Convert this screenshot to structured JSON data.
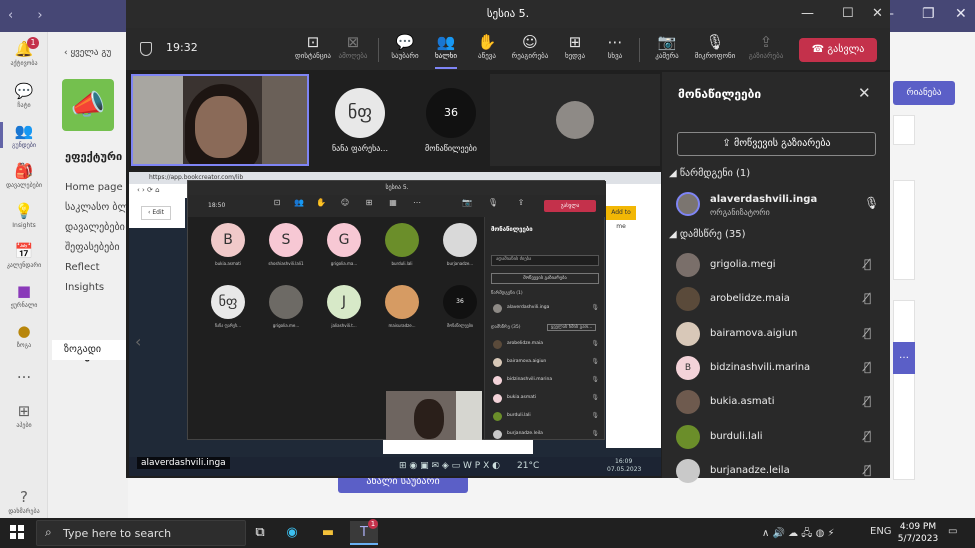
{
  "teams": {
    "rail": [
      {
        "label": "აქტივობა",
        "badge": "1"
      },
      {
        "label": "ჩატი"
      },
      {
        "label": "გუნდები"
      },
      {
        "label": "დავალებები"
      },
      {
        "label": "Insights"
      },
      {
        "label": "კალენდარი"
      },
      {
        "label": "ჟურნალი"
      },
      {
        "label": "ზოგა"
      },
      {
        "label": "..."
      },
      {
        "label": "აპები"
      },
      {
        "label": "დახმარება"
      }
    ],
    "back_label": "ყველა გუ",
    "team_name": "ეფექტური",
    "links": [
      "Home page",
      "საკლასო ბლ",
      "დავალებები",
      "შეფასებები",
      "Reflect",
      "Insights"
    ],
    "channels_header": "არხები",
    "channel": "ზოგადი",
    "right_button": "რიანება",
    "new_conversation": "ახალი საუბარი"
  },
  "meeting": {
    "title": "სესია 5.",
    "timer": "19:32",
    "toolbar": [
      {
        "label": "დისტანცია",
        "icon": "⊡"
      },
      {
        "label": "ამოღება",
        "icon": "⊠",
        "dim": true
      },
      {
        "label": "საუბარი",
        "icon": "💬"
      },
      {
        "label": "ხალხი",
        "icon": "👥",
        "selected": true
      },
      {
        "label": "აწევა",
        "icon": "✋"
      },
      {
        "label": "რეაგირება",
        "icon": "☺"
      },
      {
        "label": "ხედვა",
        "icon": "⊞"
      },
      {
        "label": "სხვა",
        "icon": "⋯"
      },
      {
        "label": "კამერა",
        "icon": "📷"
      },
      {
        "label": "მიკროფონი",
        "icon": "🎙"
      },
      {
        "label": "გაზიარება",
        "icon": "⇪",
        "dim": true
      }
    ],
    "leave_label": "გასვლა",
    "tiles": {
      "initials_tile": "ნფ",
      "initials_name": "ნანა ფარეხა...",
      "count": "36",
      "count_label": "მონაწილეები"
    }
  },
  "shared_screen": {
    "url": "https://app.bookcreator.com/lib",
    "edit": "Edit",
    "add_me": "Add to me",
    "inner_title": "სესია 5.",
    "inner_time": "18:50",
    "inner_leave": "გასვლა",
    "grid": [
      {
        "letter": "B",
        "name": "bukia.asmati",
        "color": "#f0c9c9",
        "text": "#333"
      },
      {
        "letter": "S",
        "name": "shoshiashvili.lali1",
        "color": "#f7c8d4",
        "text": "#333"
      },
      {
        "letter": "G",
        "name": "grigolia.ma...",
        "color": "#f7c8d4",
        "text": "#333"
      },
      {
        "letter": "",
        "name": "burduli.lali",
        "color": "#6b8e2a",
        "text": "#fff"
      },
      {
        "letter": "",
        "name": "burjanadze...",
        "color": "#d9d9d9",
        "text": "#333"
      },
      {
        "letter": "ნფ",
        "name": "ნანა ფარეხ...",
        "color": "#e8e8e8",
        "text": "#333"
      },
      {
        "letter": "",
        "name": "grigolia.me...",
        "color": "#6d6a65",
        "text": "#fff"
      },
      {
        "letter": "J",
        "name": "jaliashvili.t...",
        "color": "#d7e9c8",
        "text": "#333"
      },
      {
        "letter": "",
        "name": "maisuradze...",
        "color": "#d69b63",
        "text": "#fff"
      },
      {
        "letter": "36",
        "name": "მონაწილეები",
        "color": "#111111",
        "text": "#fff"
      }
    ],
    "inner_panel_title": "მონაწილეები",
    "inner_search": "ადამიანის ძიება",
    "inner_share": "მოწვევის გაზიარება",
    "inner_org_section": "წარმდგენი (1)",
    "inner_org": "alaverdashvili.inga",
    "inner_att_section": "დამსწრე (35)",
    "inner_mute_all": "ყველას ხმის გათ...",
    "inner_list": [
      "arobelidze.maia",
      "bairamova.aigiun",
      "bidzinashvili.marina",
      "bukia.asmati",
      "burduli.lali",
      "burjanadze.leila"
    ],
    "presenter_label": "alaverdashvili.inga",
    "tray_temp": "21°C",
    "tray_time": "16:09",
    "tray_date": "07.05.2023"
  },
  "panel": {
    "title": "მონაწილეები",
    "invite": "მოწვევის გაზიარება",
    "organizers_header": "წარმდგენი (1)",
    "organizer": {
      "name": "alaverdashvili.inga",
      "role": "ორგანიზატორი"
    },
    "attendees_header": "დამსწრე (35)",
    "attendees": [
      {
        "name": "grigolia.megi",
        "initial": "",
        "color": "#7a6f6a"
      },
      {
        "name": "arobelidze.maia",
        "initial": "",
        "color": "#5a4a3a"
      },
      {
        "name": "bairamova.aigiun",
        "initial": "",
        "color": "#d8c8b8"
      },
      {
        "name": "bidzinashvili.marina",
        "initial": "B",
        "color": "#f3d3d9"
      },
      {
        "name": "bukia.asmati",
        "initial": "",
        "color": "#6e5a4e"
      },
      {
        "name": "burduli.lali",
        "initial": "",
        "color": "#6b8e2a"
      },
      {
        "name": "burjanadze.leila",
        "initial": "",
        "color": "#c9c9c9"
      }
    ]
  },
  "taskbar": {
    "search_placeholder": "Type here to search",
    "language": "ENG",
    "time": "4:09 PM",
    "date": "5/7/2023",
    "teams_badge": "1"
  }
}
